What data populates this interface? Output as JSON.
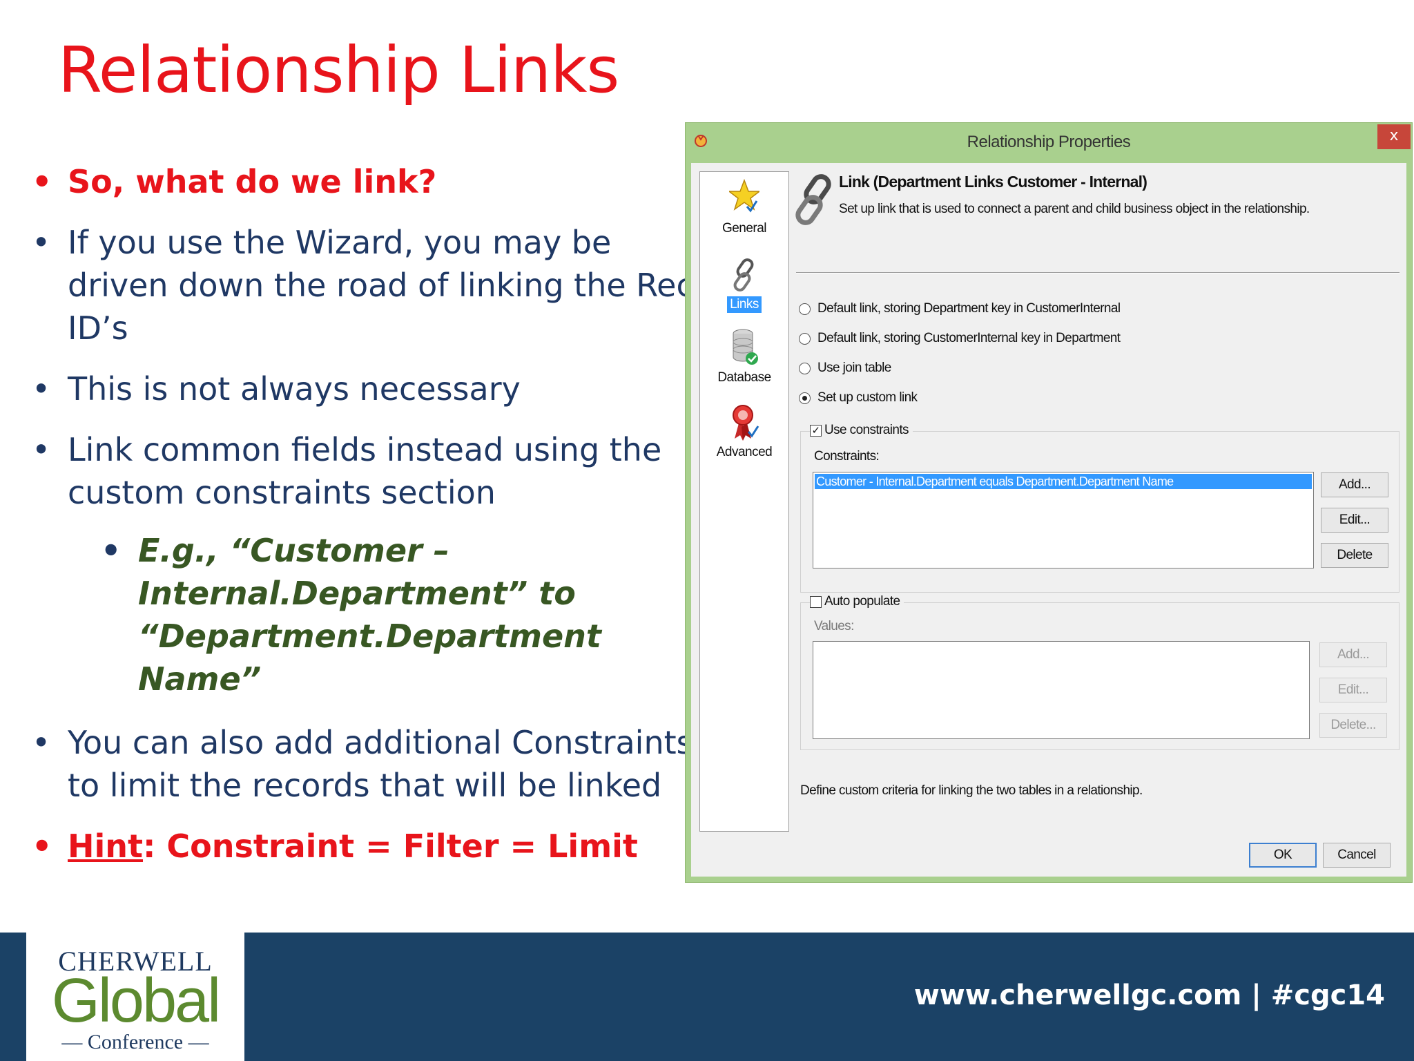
{
  "slide": {
    "title": "Relationship Links",
    "bullets": {
      "b1": "So, what do we link?",
      "b2": "If you use the Wizard, you may be driven down the road of linking the Rec ID’s",
      "b3": "This is not always necessary",
      "b4": "Link common fields instead using the custom constraints section",
      "b4_sub": "E.g., “Customer – Internal.Department” to “Department.Department Name”",
      "b5": "You can also add additional Constraints to limit the records that will be linked",
      "hint_word": "Hint",
      "hint_rest": ":  Constraint = Filter = Limit"
    }
  },
  "dialog": {
    "title": "Relationship Properties",
    "close_label": "x",
    "nav": {
      "general": "General",
      "links": "Links",
      "database": "Database",
      "advanced": "Advanced"
    },
    "header": {
      "title": "Link (Department Links Customer - Internal)",
      "description": "Set up link that is used to connect a parent and child business object in the relationship."
    },
    "options": {
      "opt1": "Default link, storing Department key in CustomerInternal",
      "opt2": "Default link, storing CustomerInternal key in Department",
      "opt3": "Use join table",
      "opt4": "Set up custom link",
      "selected": "Set up custom link"
    },
    "constraints": {
      "checkbox_label": "Use constraints",
      "checked": true,
      "list_label": "Constraints:",
      "items": [
        "Customer - Internal.Department equals Department.Department Name"
      ],
      "add": "Add...",
      "edit": "Edit...",
      "delete": "Delete"
    },
    "auto_populate": {
      "checkbox_label": "Auto populate",
      "checked": false,
      "list_label": "Values:",
      "add": "Add...",
      "edit": "Edit...",
      "delete": "Delete..."
    },
    "footer_description": "Define custom criteria for linking the two tables in a relationship.",
    "ok": "OK",
    "cancel": "Cancel"
  },
  "footer": {
    "logo_top": "CHERWELL",
    "logo_middle": "Global",
    "logo_bottom": "— Conference —",
    "url_text": "www.cherwellgc.com | #cgc14"
  },
  "colors": {
    "title_red": "#e8141b",
    "bullet_navy": "#1f3864",
    "sub_green": "#385723",
    "dialog_frame": "#a9d08e",
    "selection_blue": "#3399ff",
    "footer_navy": "#1b4266"
  }
}
